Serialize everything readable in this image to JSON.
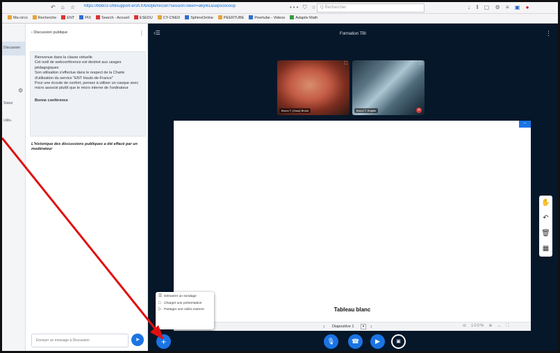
{
  "browser": {
    "nav_icons": "↶ ⌂ ☆",
    "url": "https://bbb03-ch9support-ersh.fr/b/idpb/recoin?sessionToken=a6yl61asepsoocoop",
    "url_actions": "••• ⛉ ☆",
    "search_placeholder": "Q Rechercher",
    "right_icons": "↓ ‖ ▢ ⚙ ≡",
    "ext_icon": "▣",
    "ext_icon2": "●",
    "menu_icon": "≡",
    "bookmarks": [
      "Ma circo",
      "Recherche",
      "ENT",
      "PIX",
      "Search - Accueil",
      "ESEDU",
      "CY-CNED",
      "SphinxOnline",
      "PEERTUBE",
      "Peertube - Videos",
      "Adaptiv Math"
    ]
  },
  "leftnav": {
    "selected_label": "Discussion",
    "gear": "⚙",
    "items": [
      "Statut",
      "Utilis."
    ]
  },
  "chat": {
    "header": "‹ Discussion publique",
    "kebab": "⋮",
    "welcome": {
      "paragraphs": [
        "Bienvenue dans la classe virtuelle",
        "Cet outil de webconférence est destiné aux usages pédagogiques",
        "Son utilisation s'effectue dans le respect de la Charte d'utilisation du service \"ENT Hauts-de-France\"",
        "Pour une écoute de confort, pensez à utiliser un casque avec micro associé plutôt que le micro interne de l'ordinateur"
      ],
      "closing": "Bonne conférence"
    },
    "history_notice": "L'historique des discussions publiques a été effacé par un modérateur",
    "input_placeholder": "Envoyer un message à Discussion",
    "send_icon": "➤"
  },
  "main": {
    "back_icon": "‹☰",
    "title": "Formation TBI",
    "kebab": "⋮",
    "cameras": [
      {
        "name": "Bruno T. (Vous) Bruno",
        "full": "⛶"
      },
      {
        "name": "Bruno T. Brigitte",
        "full": "⛶"
      }
    ],
    "mic_off": "✕",
    "board_corner": "–",
    "board_caption": "Tableau blanc",
    "board_nav": {
      "prev": "‹",
      "slide": "Diapositive 1",
      "drop": "▾",
      "next": "›",
      "zoom_out": "⊖",
      "zoom_level": "100%",
      "zoom_in": "⊕",
      "fit": "↔",
      "fullscreen": "⛶"
    },
    "tools": [
      "✋",
      "↶",
      "🗑",
      "▦"
    ],
    "controls": {
      "plus": "+",
      "mic": "🎙",
      "phone": "☎",
      "camera": "▶",
      "share": "▣"
    },
    "popup": {
      "options": [
        {
          "icon": "☰",
          "label": "Démarrer un sondage"
        },
        {
          "icon": "□",
          "label": "Charger une présentation"
        },
        {
          "icon": "▷",
          "label": "Partager une vidéo externe"
        }
      ]
    }
  },
  "colors": {
    "accent": "#1b74e4",
    "main_bg": "#06172a",
    "annotation_arrow": "#e01010"
  }
}
